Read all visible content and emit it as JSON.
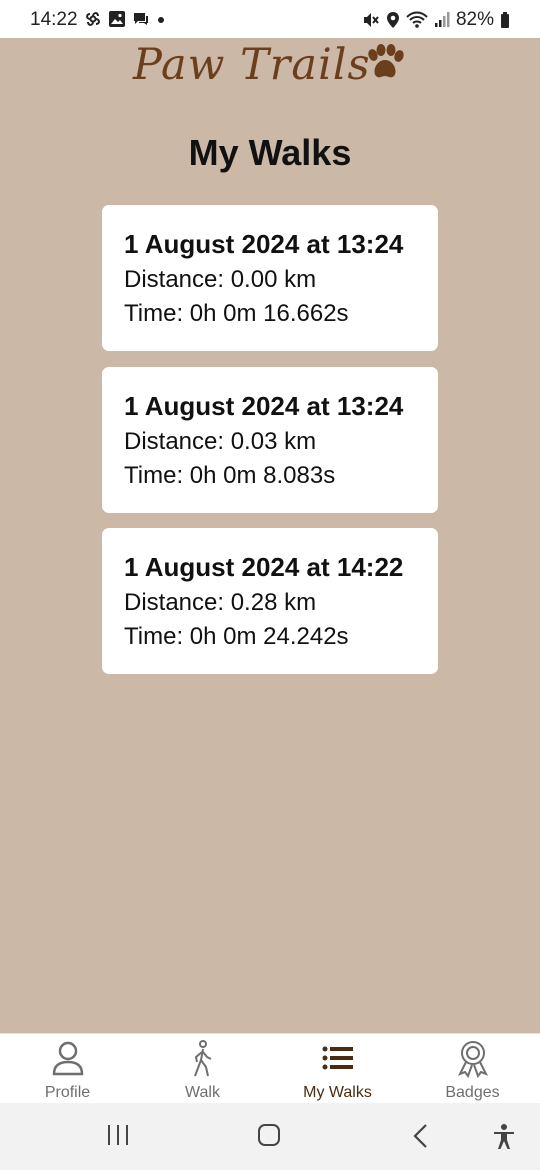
{
  "status": {
    "time": "14:22",
    "battery": "82%"
  },
  "header": {
    "app_title": "Paw Trails",
    "page_title": "My Walks"
  },
  "walks": [
    {
      "date": "1 August 2024 at 13:24",
      "distance": "Distance: 0.00 km",
      "time": "Time: 0h 0m 16.662s"
    },
    {
      "date": "1 August 2024 at 13:24",
      "distance": "Distance: 0.03 km",
      "time": "Time: 0h 0m 8.083s"
    },
    {
      "date": "1 August 2024 at 14:22",
      "distance": "Distance: 0.28 km",
      "time": "Time: 0h 0m 24.242s"
    }
  ],
  "bottom_nav": {
    "items": [
      {
        "label": "Profile",
        "icon": "person-icon"
      },
      {
        "label": "Walk",
        "icon": "walking-icon"
      },
      {
        "label": "My Walks",
        "icon": "list-icon",
        "active": true
      },
      {
        "label": "Badges",
        "icon": "badge-icon"
      }
    ]
  },
  "colors": {
    "background": "#ccb8a6",
    "brand": "#6b3f1e",
    "active_nav": "#4a2c12"
  }
}
